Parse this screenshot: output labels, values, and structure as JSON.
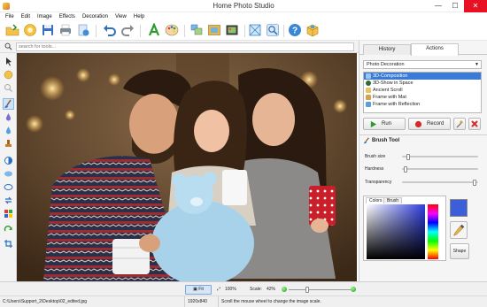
{
  "window": {
    "title": "Home Photo Studio",
    "min_glyph": "—",
    "max_glyph": "☐",
    "close_glyph": "✕"
  },
  "menu": [
    "File",
    "Edit",
    "Image",
    "Effects",
    "Decoration",
    "View",
    "Help"
  ],
  "toolbar_icons": [
    "open-icon",
    "save-icon",
    "floppy-icon",
    "print-icon",
    "export-icon",
    "undo-icon",
    "redo-icon",
    "text-icon",
    "palette-icon",
    "collage-icon",
    "frame-icon",
    "decorate-icon",
    "crop-icon",
    "zoom-icon",
    "help-icon",
    "box-icon"
  ],
  "search": {
    "placeholder": "search for tools..."
  },
  "left_tools": [
    "pointer-icon",
    "adjust-icon",
    "zoom-tool-icon",
    "brush-tool-icon",
    "drop-icon",
    "water-drop-icon",
    "stamp-icon",
    "contrast-icon",
    "blur-icon",
    "sharpen-icon",
    "swap-icon",
    "layers-icon",
    "rotate-icon",
    "crop-tool-icon"
  ],
  "panel": {
    "tabs": [
      "History",
      "Actions"
    ],
    "active_tab": "Actions",
    "dropdown_value": "Photo Decoration",
    "effects": [
      "3D-Composition",
      "3D-Show in Space",
      "Ancient Scroll",
      "Frame with Mat",
      "Frame with Reflection"
    ],
    "selected_effect": "3D-Composition",
    "run_label": "Run",
    "record_label": "Record"
  },
  "brush": {
    "title": "Brush Tool",
    "size_label": "Brush size",
    "hardness_label": "Hardness",
    "transparency_label": "Transparency",
    "size_value": 0.06,
    "hardness_value": 0.02,
    "transparency_value": 0.98,
    "color_tabs": [
      "Colors",
      "Brush"
    ],
    "selected_color": "#3a5fd9",
    "shape_label": "Shape"
  },
  "status": {
    "fit_label": "Fit",
    "zoom_label": "100%",
    "scale_label": "Scale:",
    "scale_value": "42%",
    "path": "C:\\Users\\Support_2\\Desktop\\02_edited.jpg",
    "dimensions": "1920x840",
    "hint": "Scroll the mouse wheel to change the image scale."
  },
  "colors": {
    "accent": "#3a7bd5",
    "close": "#e81123",
    "run_green": "#2e9a2e",
    "record_red": "#d62a2a"
  }
}
